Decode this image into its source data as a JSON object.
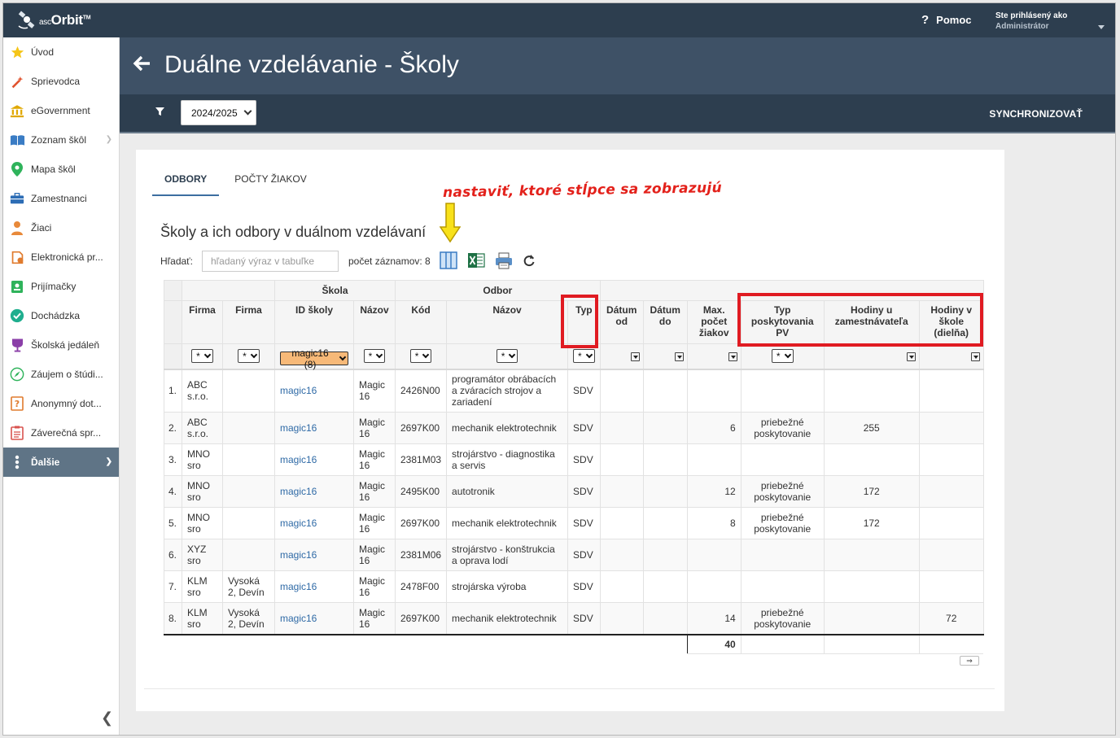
{
  "app": {
    "logo_small": "asc",
    "logo_main": "Orbit",
    "logo_tm": "TM"
  },
  "topbar": {
    "help": "Pomoc",
    "user_line1": "Ste prihlásený ako",
    "user_line2": "Administrátor"
  },
  "sidebar": {
    "items": [
      {
        "label": "Úvod",
        "icon": "star-icon"
      },
      {
        "label": "Sprievodca",
        "icon": "wand-icon"
      },
      {
        "label": "eGovernment",
        "icon": "building-icon"
      },
      {
        "label": "Zoznam škôl",
        "icon": "book-icon"
      },
      {
        "label": "Mapa škôl",
        "icon": "map-pin-icon"
      },
      {
        "label": "Zamestnanci",
        "icon": "briefcase-icon"
      },
      {
        "label": "Žiaci",
        "icon": "student-icon"
      },
      {
        "label": "Elektronická pr...",
        "icon": "document-icon"
      },
      {
        "label": "Prijímačky",
        "icon": "id-badge-icon"
      },
      {
        "label": "Dochádzka",
        "icon": "check-circle-icon"
      },
      {
        "label": "Školská jedáleň",
        "icon": "cup-icon"
      },
      {
        "label": "Záujem o štúdi...",
        "icon": "compass-icon"
      },
      {
        "label": "Anonymný dot...",
        "icon": "question-doc-icon"
      },
      {
        "label": "Záverečná spr...",
        "icon": "report-icon"
      },
      {
        "label": "Ďalšie",
        "icon": "more-icon"
      }
    ]
  },
  "header": {
    "title": "Duálne vzdelávanie - Školy"
  },
  "toolbar": {
    "year": "2024/2025",
    "sync": "SYNCHRONIZOVAŤ"
  },
  "tabs": [
    "ODBORY",
    "POČTY ŽIAKOV"
  ],
  "annotation": "nastaviť, ktoré stĺpce sa zobrazujú",
  "section_title": "Školy a ich odbory v duálnom vzdelávaní",
  "search": {
    "label": "Hľadať:",
    "placeholder": "hľadaný výraz v tabuľke"
  },
  "count_label": "počet záznamov: 8",
  "table": {
    "group_headers": {
      "skola": "Škola",
      "odbor": "Odbor"
    },
    "columns": [
      "Firma",
      "Firma",
      "ID školy",
      "Názov",
      "Kód",
      "Názov",
      "Typ",
      "Dátum od",
      "Dátum do",
      "Max. počet žiakov",
      "Typ poskytovania PV",
      "Hodiny u zamestnávateľa",
      "Hodiny v škole (dielňa)"
    ],
    "filters": {
      "any": "*",
      "id_skoly": "magic16 (8)"
    },
    "rows": [
      {
        "n": "1.",
        "firma1": "ABC s.r.o.",
        "firma2": "",
        "id": "magic16",
        "nazov": "Magic 16",
        "kod": "2426N00",
        "odbor": "programátor obrábacích a zváracích strojov a zariadení",
        "typ": "SDV",
        "od": "",
        "do": "",
        "max": "",
        "pv": "",
        "hz": "",
        "hs": ""
      },
      {
        "n": "2.",
        "firma1": "ABC s.r.o.",
        "firma2": "",
        "id": "magic16",
        "nazov": "Magic 16",
        "kod": "2697K00",
        "odbor": "mechanik elektrotechnik",
        "typ": "SDV",
        "od": "",
        "do": "",
        "max": "6",
        "pv": "priebežné poskytovanie",
        "hz": "255",
        "hs": ""
      },
      {
        "n": "3.",
        "firma1": "MNO sro",
        "firma2": "",
        "id": "magic16",
        "nazov": "Magic 16",
        "kod": "2381M03",
        "odbor": "strojárstvo - diagnostika a servis",
        "typ": "SDV",
        "od": "",
        "do": "",
        "max": "",
        "pv": "",
        "hz": "",
        "hs": ""
      },
      {
        "n": "4.",
        "firma1": "MNO sro",
        "firma2": "",
        "id": "magic16",
        "nazov": "Magic 16",
        "kod": "2495K00",
        "odbor": "autotronik",
        "typ": "SDV",
        "od": "",
        "do": "",
        "max": "12",
        "pv": "priebežné poskytovanie",
        "hz": "172",
        "hs": ""
      },
      {
        "n": "5.",
        "firma1": "MNO sro",
        "firma2": "",
        "id": "magic16",
        "nazov": "Magic 16",
        "kod": "2697K00",
        "odbor": "mechanik elektrotechnik",
        "typ": "SDV",
        "od": "",
        "do": "",
        "max": "8",
        "pv": "priebežné poskytovanie",
        "hz": "172",
        "hs": ""
      },
      {
        "n": "6.",
        "firma1": "XYZ sro",
        "firma2": "",
        "id": "magic16",
        "nazov": "Magic 16",
        "kod": "2381M06",
        "odbor": "strojárstvo - konštrukcia a oprava lodí",
        "typ": "SDV",
        "od": "",
        "do": "",
        "max": "",
        "pv": "",
        "hz": "",
        "hs": ""
      },
      {
        "n": "7.",
        "firma1": "KLM sro",
        "firma2": "Vysoká 2, Devín",
        "id": "magic16",
        "nazov": "Magic 16",
        "kod": "2478F00",
        "odbor": "strojárska výroba",
        "typ": "SDV",
        "od": "",
        "do": "",
        "max": "",
        "pv": "",
        "hz": "",
        "hs": ""
      },
      {
        "n": "8.",
        "firma1": "KLM sro",
        "firma2": "Vysoká 2, Devín",
        "id": "magic16",
        "nazov": "Magic 16",
        "kod": "2697K00",
        "odbor": "mechanik elektrotechnik",
        "typ": "SDV",
        "od": "",
        "do": "",
        "max": "14",
        "pv": "priebežné poskytovanie",
        "hz": "",
        "hs": "72"
      }
    ],
    "sum_max": "40",
    "next_page": "⇒"
  },
  "colors": {
    "topbar": "#2d3e4f",
    "banner": "#3e5166",
    "active_nav": "#5f7486",
    "link": "#2f6aa6",
    "highlight_red": "#e01b22",
    "annotation_red": "#e3211b",
    "filter_orange": "#f7b978"
  }
}
